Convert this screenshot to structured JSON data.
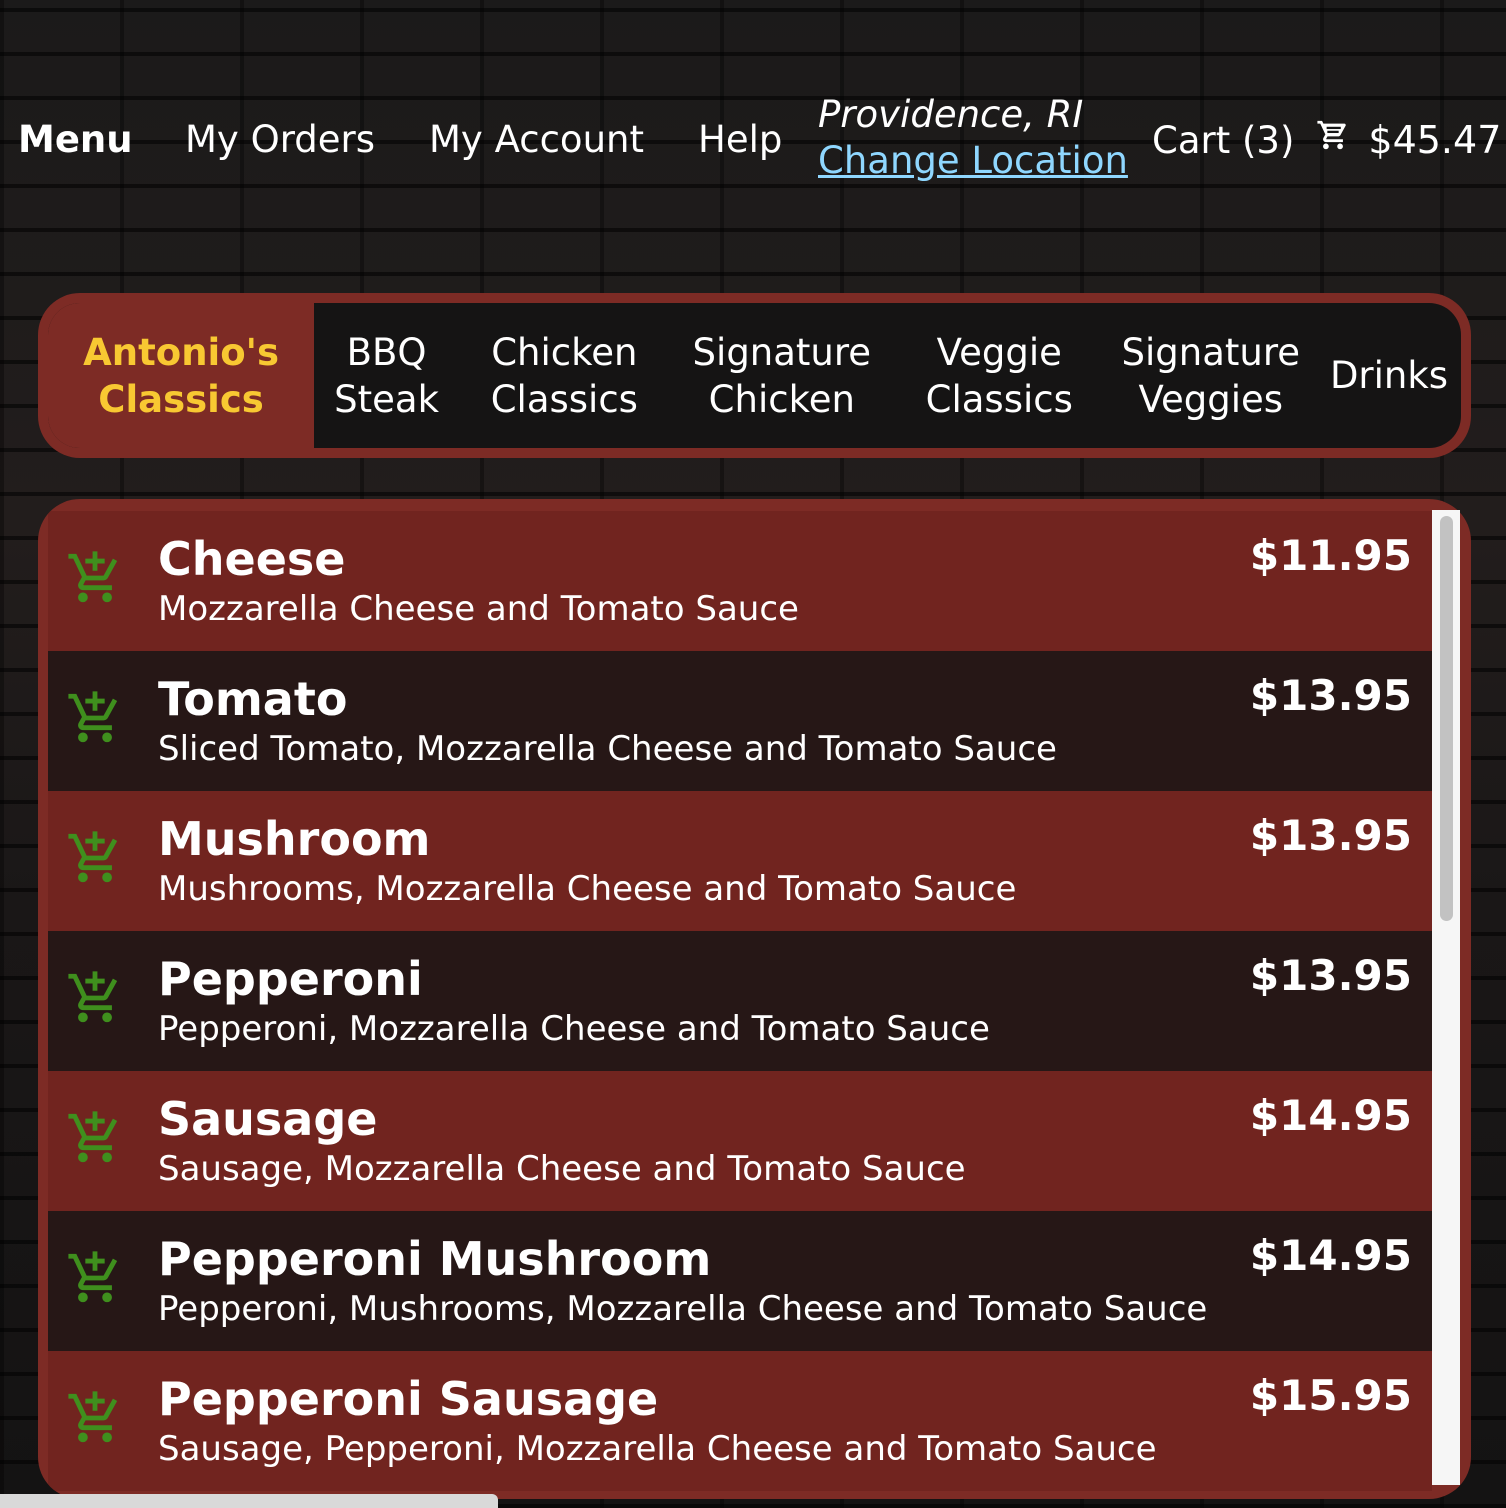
{
  "nav": {
    "menu": "Menu",
    "my_orders": "My Orders",
    "my_account": "My Account",
    "help": "Help",
    "location_city": "Providence, RI",
    "change_location": "Change Location",
    "cart_label": "Cart (3)",
    "cart_icon": "cart-icon",
    "cart_total": "$45.47"
  },
  "tabs": [
    {
      "line1": "Antonio's",
      "line2": "Classics",
      "active": true
    },
    {
      "line1": "BBQ",
      "line2": "Steak"
    },
    {
      "line1": "Chicken",
      "line2": "Classics"
    },
    {
      "line1": "Signature",
      "line2": "Chicken"
    },
    {
      "line1": "Veggie",
      "line2": "Classics"
    },
    {
      "line1": "Signature",
      "line2": "Veggies"
    },
    {
      "line1": "Drinks",
      "line2": ""
    }
  ],
  "items": [
    {
      "name": "Cheese",
      "desc": "Mozzarella Cheese and Tomato Sauce",
      "price": "$11.95"
    },
    {
      "name": "Tomato",
      "desc": "Sliced Tomato, Mozzarella Cheese and Tomato Sauce",
      "price": "$13.95"
    },
    {
      "name": "Mushroom",
      "desc": "Mushrooms, Mozzarella Cheese and Tomato Sauce",
      "price": "$13.95"
    },
    {
      "name": "Pepperoni",
      "desc": "Pepperoni, Mozzarella Cheese and Tomato Sauce",
      "price": "$13.95"
    },
    {
      "name": "Sausage",
      "desc": "Sausage, Mozzarella Cheese and Tomato Sauce",
      "price": "$14.95"
    },
    {
      "name": "Pepperoni Mushroom",
      "desc": "Pepperoni, Mushrooms, Mozzarella Cheese and Tomato Sauce",
      "price": "$14.95"
    },
    {
      "name": "Pepperoni Sausage",
      "desc": "Sausage, Pepperoni, Mozzarella Cheese and Tomato Sauce",
      "price": "$15.95"
    }
  ],
  "colors": {
    "accent_red": "#7d2b25",
    "active_tab_text": "#f8c832",
    "link": "#8fd7ff",
    "add_to_cart_icon": "#3f8f1d"
  },
  "row_icon": "add-to-cart-icon"
}
